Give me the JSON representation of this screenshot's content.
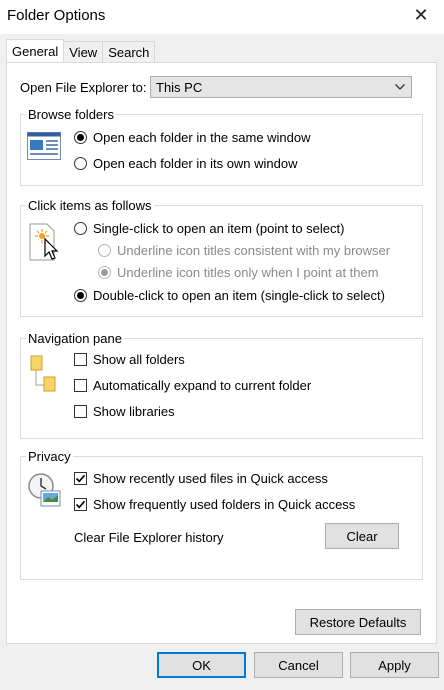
{
  "window": {
    "title": "Folder Options",
    "close_glyph": "✕"
  },
  "tabs": [
    {
      "label": "General",
      "active": true
    },
    {
      "label": "View",
      "active": false
    },
    {
      "label": "Search",
      "active": false
    }
  ],
  "open_explorer": {
    "label": "Open File Explorer to:",
    "value": "This PC"
  },
  "browse_folders": {
    "legend": "Browse folders",
    "icon": "window-layout-icon",
    "options": [
      {
        "label": "Open each folder in the same window",
        "checked": true
      },
      {
        "label": "Open each folder in its own window",
        "checked": false
      }
    ]
  },
  "click_items": {
    "legend": "Click items as follows",
    "icon": "click-cursor-icon",
    "single": {
      "label": "Single-click to open an item (point to select)",
      "checked": false
    },
    "underline_browser": {
      "label": "Underline icon titles consistent with my browser",
      "checked": false,
      "enabled": false
    },
    "underline_point": {
      "label": "Underline icon titles only when I point at them",
      "checked": true,
      "enabled": false
    },
    "double": {
      "label": "Double-click to open an item (single-click to select)",
      "checked": true
    }
  },
  "navigation_pane": {
    "legend": "Navigation pane",
    "icon": "folder-tree-icon",
    "options": [
      {
        "label": "Show all folders",
        "checked": false
      },
      {
        "label": "Automatically expand to current folder",
        "checked": false
      },
      {
        "label": "Show libraries",
        "checked": false
      }
    ]
  },
  "privacy": {
    "legend": "Privacy",
    "icon": "clock-files-icon",
    "options": [
      {
        "label": "Show recently used files in Quick access",
        "checked": true
      },
      {
        "label": "Show frequently used folders in Quick access",
        "checked": true
      }
    ],
    "clear_history_label": "Clear File Explorer history",
    "clear_button": "Clear"
  },
  "restore_defaults": "Restore Defaults",
  "footer": {
    "ok": "OK",
    "cancel": "Cancel",
    "apply": "Apply"
  },
  "colors": {
    "accent": "#0078d7",
    "dialog_bg": "#f0f0f0",
    "button_bg": "#e1e1e1"
  }
}
